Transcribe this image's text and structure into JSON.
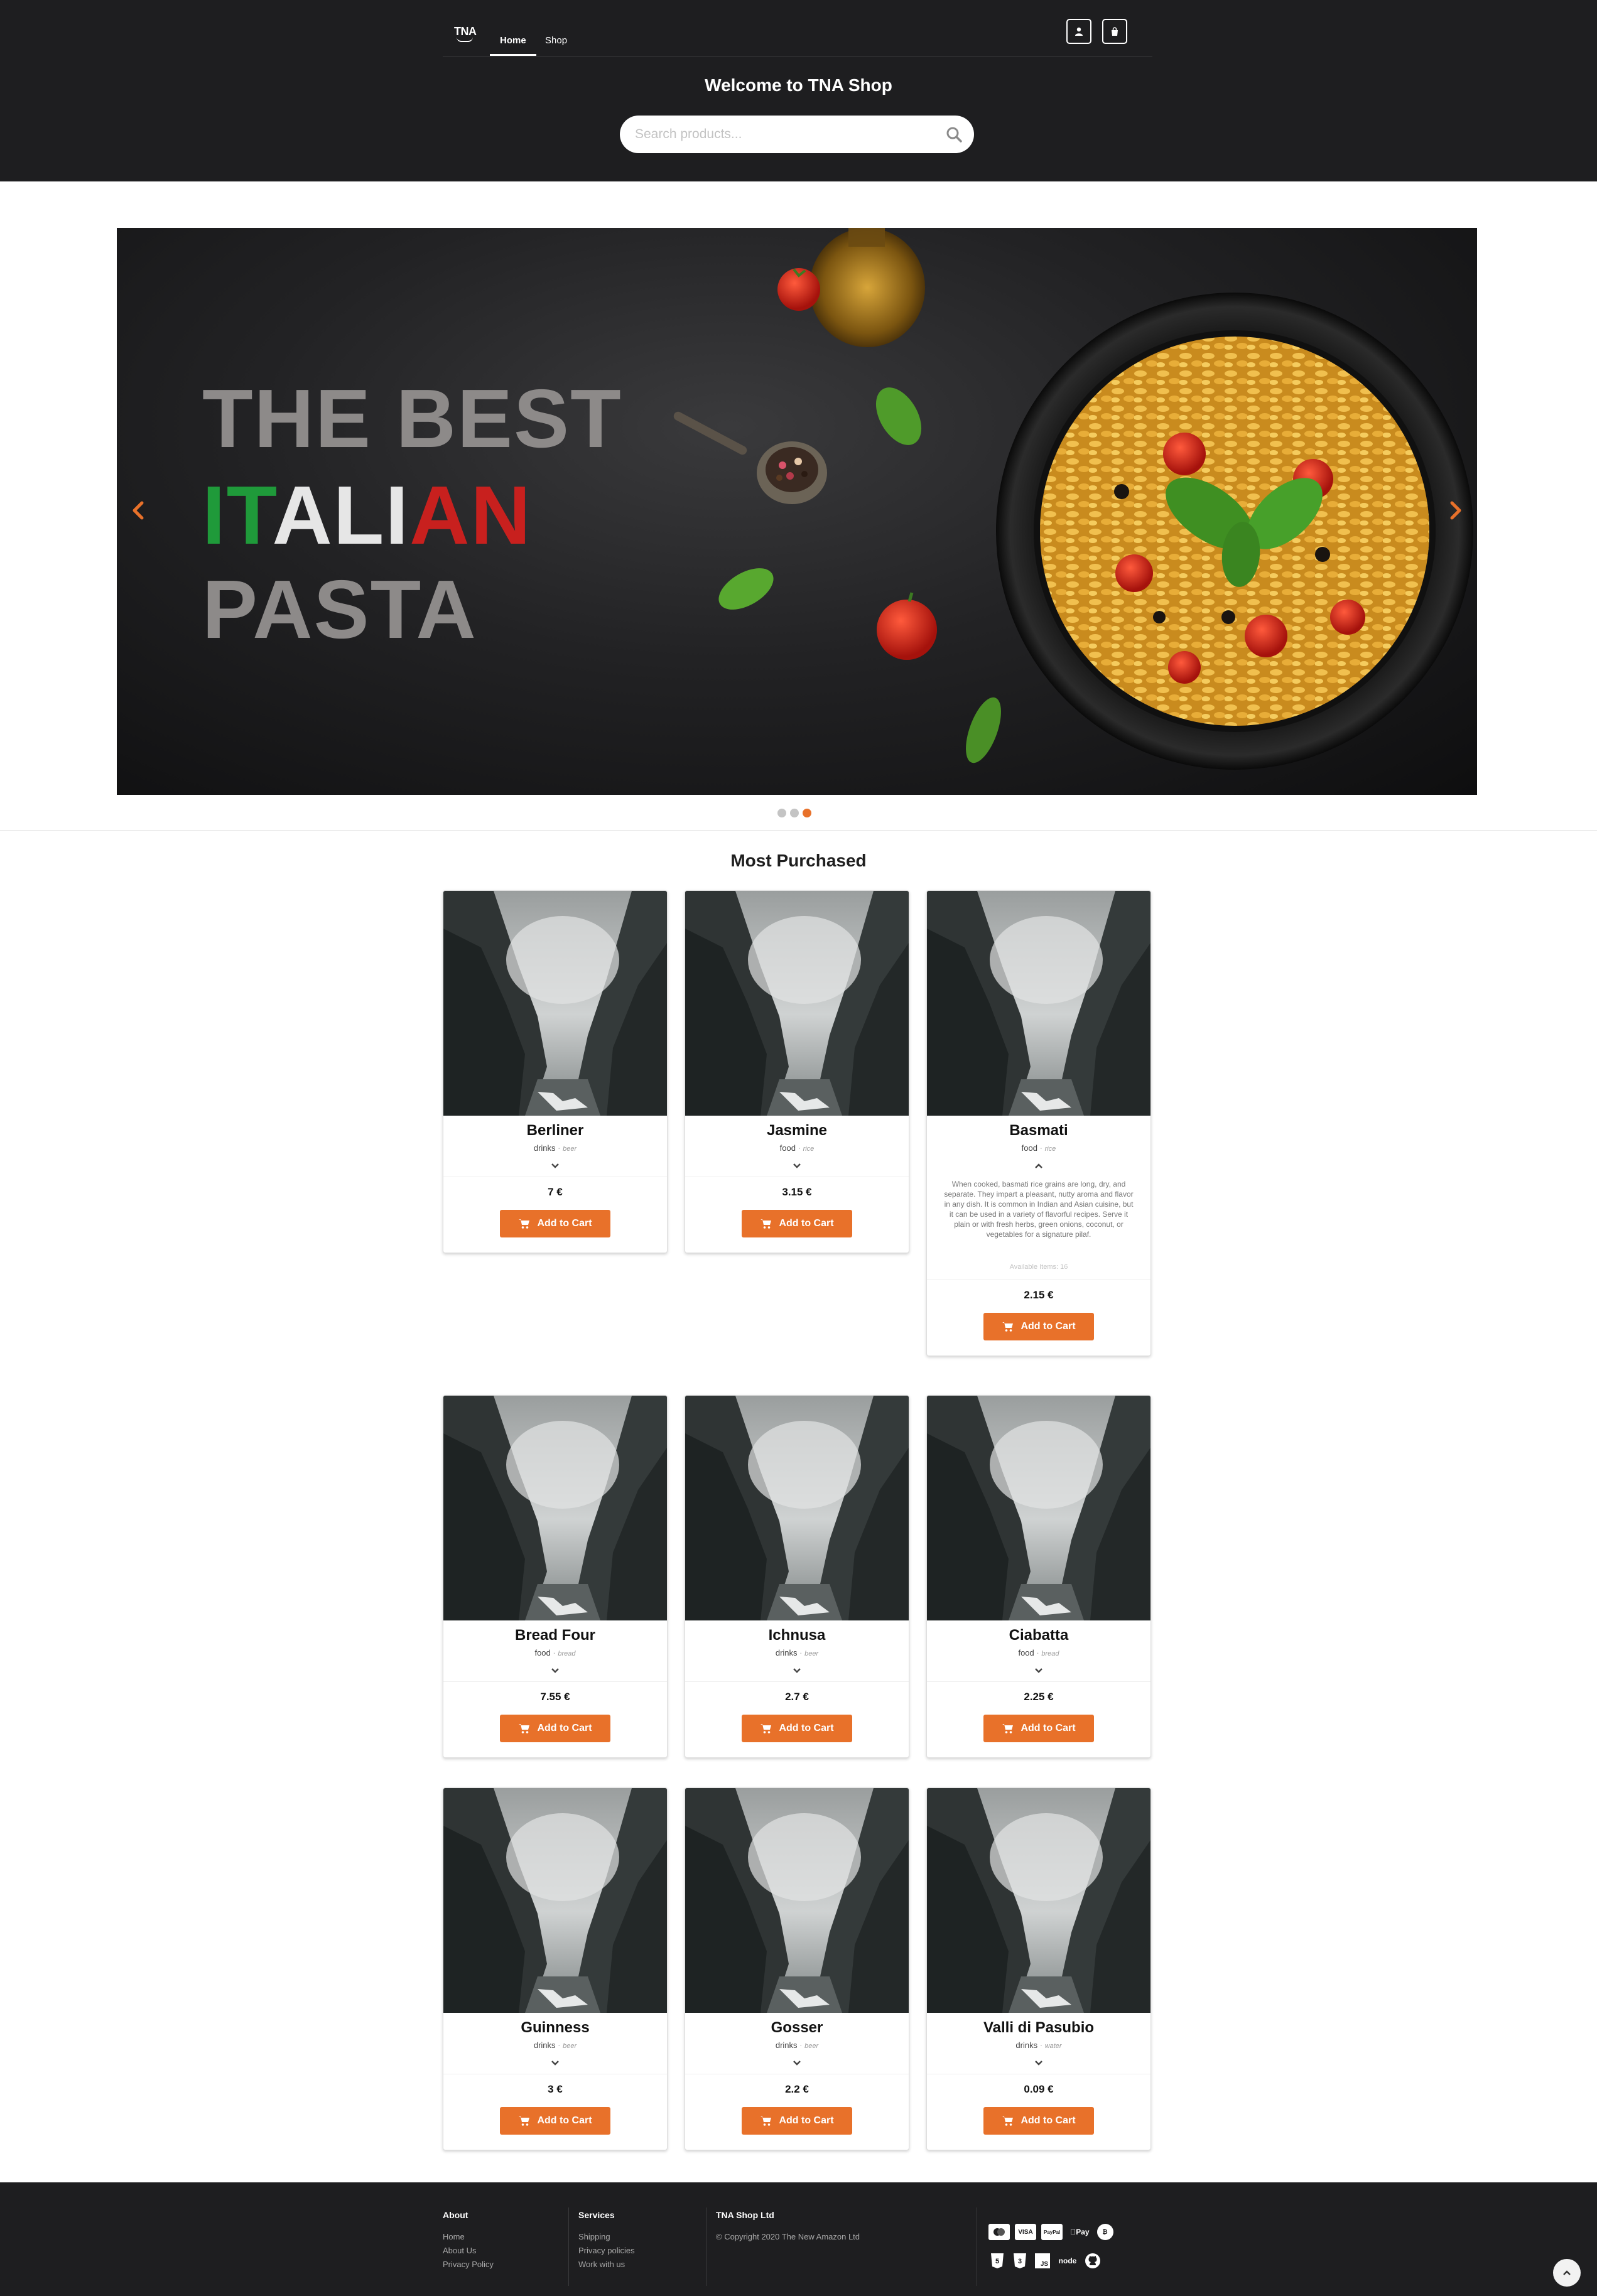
{
  "header": {
    "logo": "TNA",
    "tabs": [
      {
        "label": "Home"
      },
      {
        "label": "Shop"
      }
    ],
    "welcome": "Welcome to TNA Shop",
    "search_placeholder": "Search products..."
  },
  "carousel": {
    "line1": "THE BEST",
    "line2_green": "IT",
    "line2_white": "ALI",
    "line2_red": "AN",
    "line3": "PASTA",
    "slides": 3,
    "active_slide": 3
  },
  "section": {
    "title": "Most Purchased"
  },
  "products": [
    {
      "name": "Berliner",
      "category": "drinks",
      "subcategory": "beer",
      "price": "7 €",
      "add_label": "Add to Cart"
    },
    {
      "name": "Jasmine",
      "category": "food",
      "subcategory": "rice",
      "price": "3.15 €",
      "add_label": "Add to Cart"
    },
    {
      "name": "Basmati",
      "category": "food",
      "subcategory": "rice",
      "price": "2.15 €",
      "add_label": "Add to Cart",
      "description": "When cooked, basmati rice grains are long, dry, and separate. They impart a pleasant, nutty aroma and flavor in any dish. It is common in Indian and Asian cuisine, but it can be used in a variety of flavorful recipes. Serve it plain or with fresh herbs, green onions, coconut, or vegetables for a signature pilaf.",
      "available": "Available Items: 16"
    },
    {
      "name": "Bread Four",
      "category": "food",
      "subcategory": "bread",
      "price": "7.55 €",
      "add_label": "Add to Cart"
    },
    {
      "name": "Ichnusa",
      "category": "drinks",
      "subcategory": "beer",
      "price": "2.7 €",
      "add_label": "Add to Cart"
    },
    {
      "name": "Ciabatta",
      "category": "food",
      "subcategory": "bread",
      "price": "2.25 €",
      "add_label": "Add to Cart"
    },
    {
      "name": "Guinness",
      "category": "drinks",
      "subcategory": "beer",
      "price": "3 €",
      "add_label": "Add to Cart"
    },
    {
      "name": "Gosser",
      "category": "drinks",
      "subcategory": "beer",
      "price": "2.2 €",
      "add_label": "Add to Cart"
    },
    {
      "name": "Valli di Pasubio",
      "category": "drinks",
      "subcategory": "water",
      "price": "0.09 €",
      "add_label": "Add to Cart"
    }
  ],
  "footer": {
    "about": {
      "title": "About",
      "links": [
        "Home",
        "About Us",
        "Privacy Policy"
      ]
    },
    "services": {
      "title": "Services",
      "links": [
        "Shipping",
        "Privacy policies",
        "Work with us"
      ]
    },
    "company": {
      "title": "TNA Shop Ltd",
      "copyright": "© Copyright 2020 The New Amazon Ltd"
    },
    "payments": [
      "mastercard-icon",
      "VISA",
      "PayPal",
      "Pay",
      "bitcoin-icon"
    ],
    "apple_pay": "Pay",
    "tech": [
      "html5-icon",
      "css3-icon",
      "js-icon",
      "node-icon",
      "github-icon"
    ],
    "node_label": "node"
  },
  "colors": {
    "accent": "#e8712a",
    "header_bg": "#1e1e20",
    "italy_green": "#1f9a3a",
    "italy_red": "#c8201e"
  }
}
